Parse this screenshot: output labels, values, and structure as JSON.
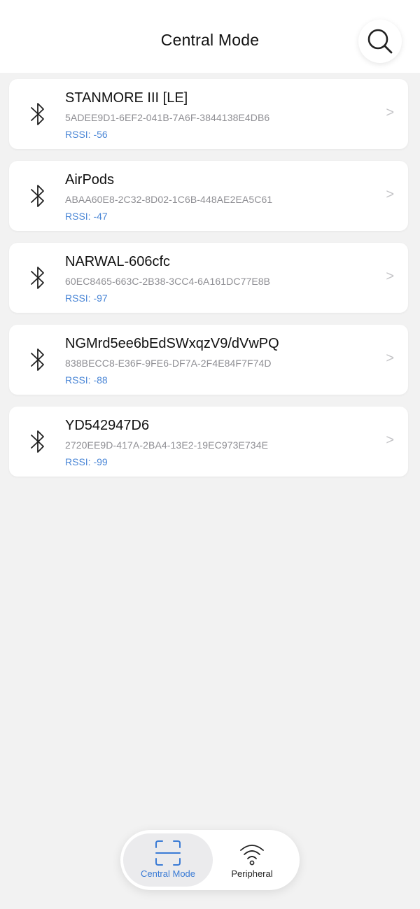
{
  "header": {
    "title": "Central Mode",
    "search_icon": "search-icon"
  },
  "devices": [
    {
      "name": "STANMORE III [LE]",
      "uuid": "5ADEE9D1-6EF2-041B-7A6F-3844138E4DB6",
      "rssi": "RSSI: -56",
      "icon": "bluetooth-icon",
      "chevron": ">"
    },
    {
      "name": "AirPods",
      "uuid": "ABAA60E8-2C32-8D02-1C6B-448AE2EA5C61",
      "rssi": "RSSI: -47",
      "icon": "bluetooth-icon",
      "chevron": ">"
    },
    {
      "name": "NARWAL-606cfc",
      "uuid": "60EC8465-663C-2B38-3CC4-6A161DC77E8B",
      "rssi": "RSSI: -97",
      "icon": "bluetooth-icon",
      "chevron": ">"
    },
    {
      "name": "NGMrd5ee6bEdSWxqzV9/dVwPQ",
      "uuid": "838BECC8-E36F-9FE6-DF7A-2F4E84F7F74D",
      "rssi": "RSSI: -88",
      "icon": "bluetooth-icon",
      "chevron": ">"
    },
    {
      "name": "YD542947D6",
      "uuid": "2720EE9D-417A-2BA4-13E2-19EC973E734E",
      "rssi": "RSSI: -99",
      "icon": "bluetooth-icon",
      "chevron": ">"
    }
  ],
  "tabbar": {
    "tabs": [
      {
        "label": "Central Mode",
        "icon": "scan-icon",
        "selected": true
      },
      {
        "label": "Peripheral",
        "icon": "wifi-broadcast-icon",
        "selected": false
      }
    ]
  },
  "colors": {
    "accent": "#3a7bd5",
    "rssi": "#4a86d6",
    "background": "#f2f2f2",
    "card": "#ffffff"
  }
}
